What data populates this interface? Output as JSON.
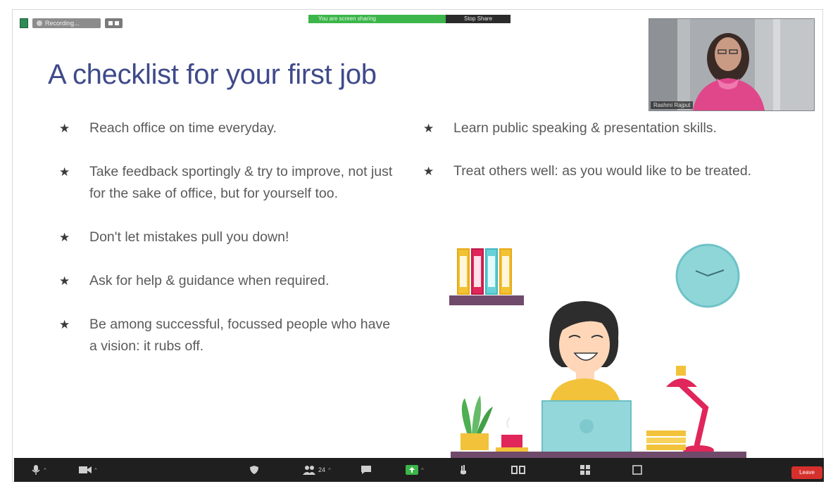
{
  "status_bar": {
    "recording_label": "Recording..."
  },
  "share_bar": {
    "sharing_label": "You are screen sharing",
    "stop_label": "Stop Share"
  },
  "slide": {
    "title": "A checklist for your first job",
    "left_bullets": [
      "Reach office on time everyday.",
      "Take feedback sportingly & try to improve, not just for the sake of office, but for yourself too.",
      "Don't let mistakes pull you down!",
      "Ask for help & guidance when required.",
      "Be among successful, focussed people who have a vision: it rubs off."
    ],
    "right_bullets": [
      "Learn public speaking & presentation skills.",
      "Treat others well: as you would like to be treated."
    ],
    "bullet_glyph": "★"
  },
  "video": {
    "participant_name": "Rashmi Rajput"
  },
  "toolbar": {
    "participants_count": "24",
    "leave_label": "Leave"
  },
  "colors": {
    "title": "#3f4a8a",
    "toolbar_bg": "#1f1f1f",
    "leave": "#d6302c",
    "share_green": "#3cb64a"
  }
}
